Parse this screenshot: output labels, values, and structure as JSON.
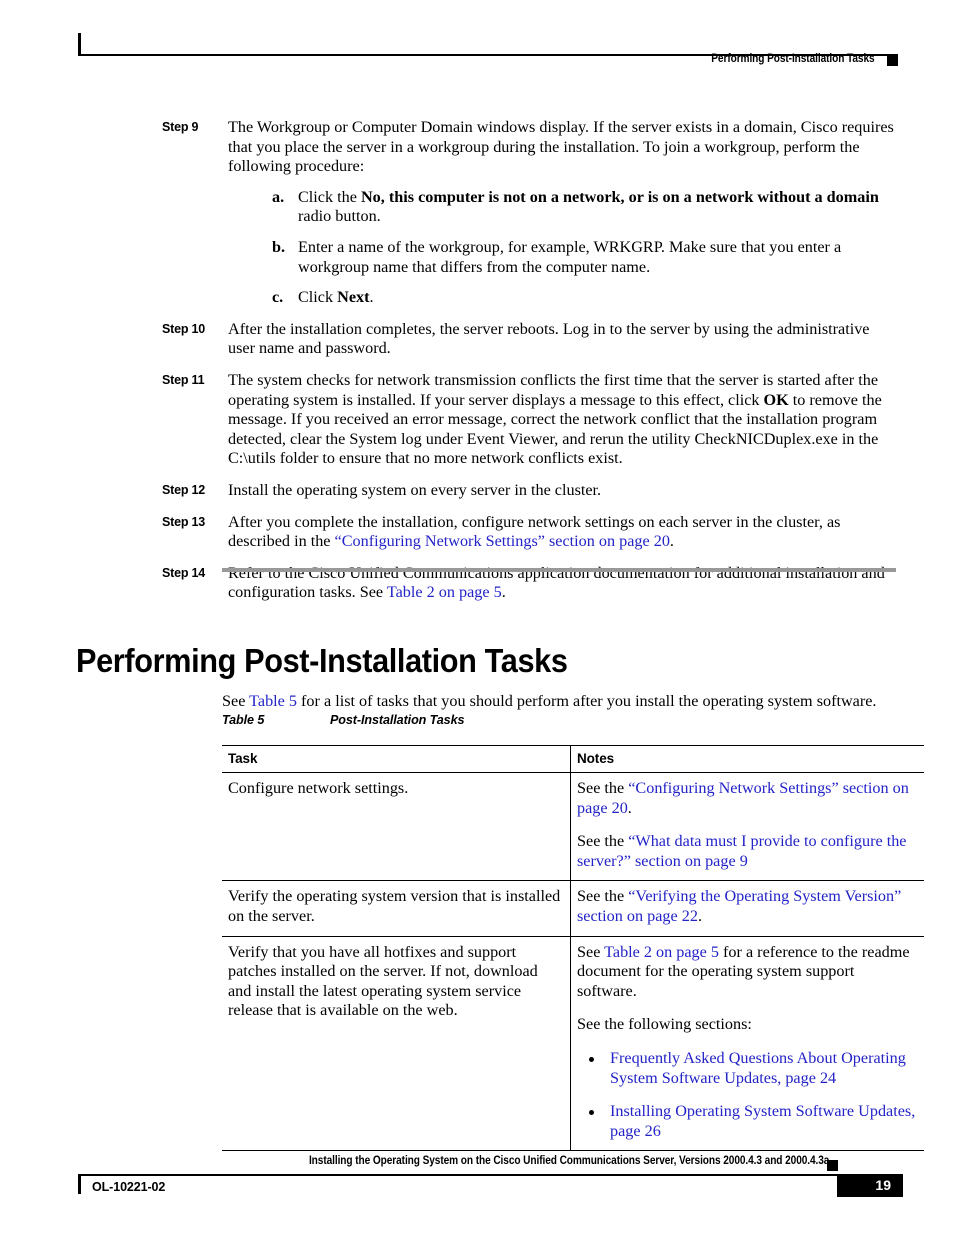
{
  "header": {
    "title": "Performing Post-Installation Tasks"
  },
  "steps": [
    {
      "label": "Step 9",
      "text_1": "The Workgroup or Computer Domain windows display. If the server exists in a domain, Cisco requires that you place the server in a workgroup during the installation. To join a workgroup, perform the following procedure:",
      "substeps": [
        {
          "label": "a.",
          "text_1": "Click the ",
          "bold_1": "No, this computer is not on a network, or is on a network without a domain",
          "text_2": " radio button."
        },
        {
          "label": "b.",
          "text_1": "Enter a name of the workgroup, for example, WRKGRP. Make sure that you enter a workgroup name that differs from the computer name."
        },
        {
          "label": "c.",
          "text_1": "Click ",
          "bold_1": "Next",
          "text_2": "."
        }
      ]
    },
    {
      "label": "Step 10",
      "text_1": "After the installation completes, the server reboots. Log in to the server by using the administrative user name and password."
    },
    {
      "label": "Step 11",
      "text_1": "The system checks for network transmission conflicts the first time that the server is started after the operating system is installed. If your server displays a message to this effect, click ",
      "bold_1": "OK",
      "text_2": " to remove the message. If you received an error message, correct the network conflict that the installation program detected, clear the System log under Event Viewer, and rerun the utility CheckNICDuplex.exe in the C:\\utils folder to ensure that no more network conflicts exist."
    },
    {
      "label": "Step 12",
      "text_1": "Install the operating system on every server in the cluster."
    },
    {
      "label": "Step 13",
      "text_1": "After you complete the installation, configure network settings on each server in the cluster, as described in the ",
      "link_1": "“Configuring Network Settings” section on page 20",
      "text_2": "."
    },
    {
      "label": "Step 14",
      "text_1": "Refer to the Cisco Unified Communications application documentation for additional installation and configuration tasks. See ",
      "link_1": "Table 2 on page 5",
      "text_2": "."
    }
  ],
  "section": {
    "heading": "Performing Post-Installation Tasks",
    "intro_text_1": "See ",
    "intro_link": "Table 5",
    "intro_text_2": " for a list of tasks that you should perform after you install the operating system software."
  },
  "table": {
    "caption_number": "Table 5",
    "caption_title": "Post-Installation Tasks",
    "headers": {
      "task": "Task",
      "notes": "Notes"
    },
    "rows": [
      {
        "task": "Configure network settings.",
        "notes_p1_text_1": "See the ",
        "notes_p1_link": "“Configuring Network Settings” section on page 20",
        "notes_p1_text_2": ".",
        "notes_p2_text_1": "See the ",
        "notes_p2_link": "“What data must I provide to configure the server?” section on page 9",
        "notes_p2_text_2": ""
      },
      {
        "task": "Verify the operating system version that is installed on the server.",
        "notes_p1_text_1": "See the ",
        "notes_p1_link": "“Verifying the Operating System Version” section on page 22",
        "notes_p1_text_2": "."
      },
      {
        "task": "Verify that you have all hotfixes and support patches installed on the server. If not, download and install the latest operating system service release that is available on the web.",
        "notes_p1_text_1": "See ",
        "notes_p1_link": "Table 2 on page 5",
        "notes_p1_text_2": " for a reference to the readme document for the operating system support software.",
        "notes_p2_text_1": "See the following sections:",
        "bullets": [
          "Frequently Asked Questions About Operating System Software Updates, page 24",
          "Installing Operating System Software Updates, page 26"
        ]
      }
    ]
  },
  "footer": {
    "doc_title": "Installing the Operating System on the Cisco Unified Communications Server, Versions 2000.4.3 and 2000.4.3a",
    "doc_id": "OL-10221-02",
    "page_number": "19"
  },
  "colors": {
    "link": "#2323c8",
    "rule_gray": "#999999",
    "text": "#000000"
  }
}
